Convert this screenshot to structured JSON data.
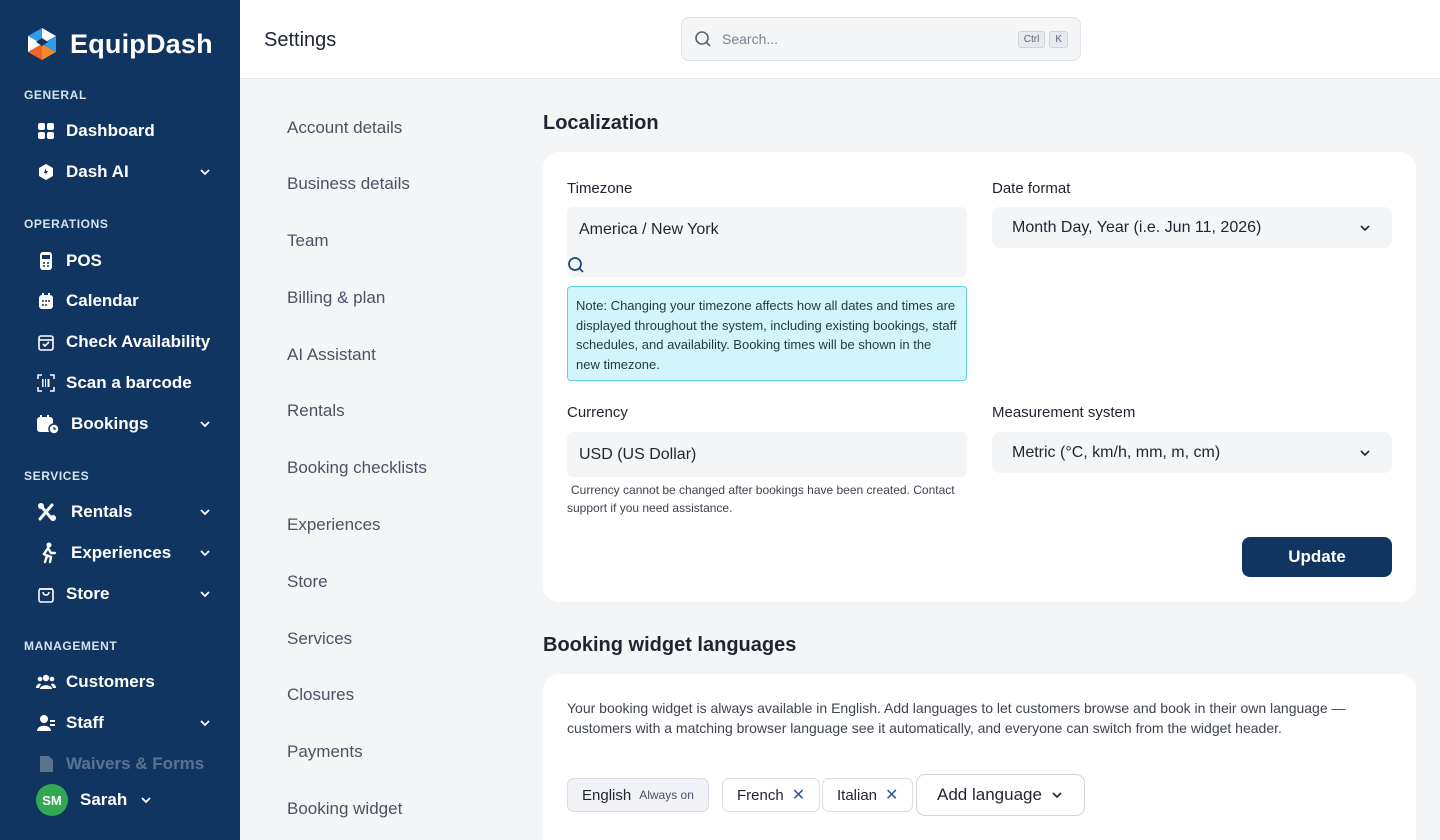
{
  "brand": {
    "name": "EquipDash"
  },
  "sidebar": {
    "sections": [
      {
        "label": "GENERAL"
      },
      {
        "label": "OPERATIONS"
      },
      {
        "label": "SERVICES"
      },
      {
        "label": "MANAGEMENT"
      }
    ],
    "items": [
      {
        "label": "Dashboard",
        "icon": "grid-icon"
      },
      {
        "label": "Dash AI",
        "icon": "ai-hex-icon"
      },
      {
        "label": "POS",
        "icon": "pos-terminal-icon"
      },
      {
        "label": "Calendar",
        "icon": "calendar-icon"
      },
      {
        "label": "Check Availability",
        "icon": "calendar-check-icon"
      },
      {
        "label": "Scan a barcode",
        "icon": "barcode-icon"
      },
      {
        "label": "Bookings",
        "icon": "bookings-icon"
      },
      {
        "label": "Rentals",
        "icon": "tools-icon"
      },
      {
        "label": "Experiences",
        "icon": "person-activity-icon"
      },
      {
        "label": "Store",
        "icon": "shopping-bag-icon"
      },
      {
        "label": "Customers",
        "icon": "users-icon"
      },
      {
        "label": "Staff",
        "icon": "staff-icon"
      },
      {
        "label": "Waivers & Forms",
        "icon": "document-icon"
      }
    ],
    "user": {
      "initials": "SM",
      "name": "Sarah"
    }
  },
  "topbar": {
    "title": "Settings",
    "search_placeholder": "Search...",
    "kbd1": "Ctrl",
    "kbd2": "K"
  },
  "settings_nav": [
    "Account details",
    "Business details",
    "Team",
    "Billing & plan",
    "AI Assistant",
    "Rentals",
    "Booking checklists",
    "Experiences",
    "Store",
    "Services",
    "Closures",
    "Payments",
    "Booking widget"
  ],
  "localization": {
    "title": "Localization",
    "timezone_label": "Timezone",
    "timezone_value": "America / New York",
    "timezone_note": "Note: Changing your timezone affects how all dates and times are displayed throughout the system, including existing bookings, staff schedules, and availability. Booking times will be shown in the new timezone.",
    "date_format_label": "Date format",
    "date_format_value": "Month Day, Year (i.e. Jun 11, 2026)",
    "currency_label": "Currency",
    "currency_value": "USD (US Dollar)",
    "currency_help": "Currency cannot be changed after bookings have been created. Contact support if you need assistance.",
    "measurement_label": "Measurement system",
    "measurement_value": "Metric (°C, km/h, mm, m, cm)",
    "update_label": "Update"
  },
  "widget_languages": {
    "title": "Booking widget languages",
    "description": "Your booking widget is always available in English. Add languages to let customers browse and book in their own language — customers with a matching browser language see it automatically, and everyone can switch from the widget header.",
    "chips": [
      {
        "label": "English",
        "tag": "Always on"
      },
      {
        "label": "French"
      },
      {
        "label": "Italian"
      }
    ],
    "add_label": "Add language"
  },
  "colors": {
    "sidebar": "#103560",
    "accent": "#103560",
    "note_bg": "#d2f4fb",
    "avatar": "#33a852"
  }
}
